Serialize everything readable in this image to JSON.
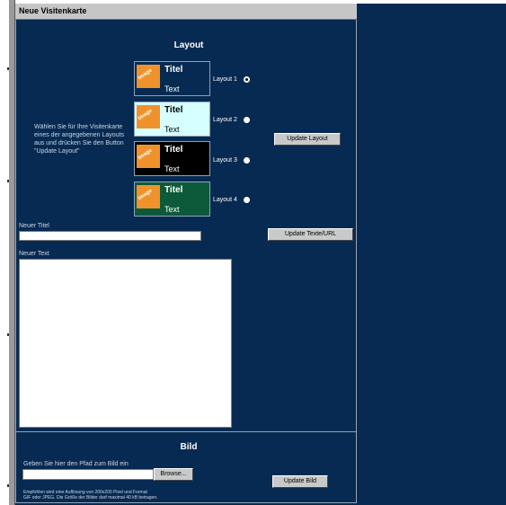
{
  "window": {
    "title": "Neue Visitenkarte"
  },
  "layout_section": {
    "heading": "Layout",
    "instructions": [
      "Wählen Sie für Ihre Visitenkarte",
      "eines der angegebenen Layouts",
      "aus und drücken Sie den Button",
      "\"Update Layout\""
    ],
    "options": [
      {
        "label": "Layout 1",
        "card_title": "Titel",
        "card_text": "Text",
        "image_label": "Image",
        "bg": "#072a52",
        "title_color": "#ffffff",
        "text_color": "#ffffff",
        "checked": true
      },
      {
        "label": "Layout 2",
        "card_title": "Titel",
        "card_text": "Text",
        "image_label": "Image",
        "bg": "#d6ffff",
        "title_color": "#000000",
        "text_color": "#000000",
        "checked": false
      },
      {
        "label": "Layout 3",
        "card_title": "Titel",
        "card_text": "Text",
        "image_label": "Image",
        "bg": "#000000",
        "title_color": "#ffffff",
        "text_color": "#ffffff",
        "checked": false
      },
      {
        "label": "Layout 4",
        "card_title": "Titel",
        "card_text": "Text",
        "image_label": "Image",
        "bg": "#0c5a3a",
        "title_color": "#ffffff",
        "text_color": "#ffffff",
        "checked": false
      }
    ],
    "update_button": "Update Layout"
  },
  "text_section": {
    "title_label": "Neuer Titel",
    "title_value": "",
    "update_button": "Update Texte/URL",
    "text_label": "Neuer Text",
    "text_value": ""
  },
  "image_section": {
    "heading": "Bild",
    "path_label": "Geben Sie hier den Pfad zum Bild ein",
    "path_value": "",
    "browse_button": "Browse...",
    "update_button": "Update Bild",
    "note": [
      "Empfohlen wird eine Auflösung von 200x200 Pixel und Format",
      "GIF oder JPEG. Die Größe der Bilder darf maximal 40 kB betragen."
    ]
  },
  "colors": {
    "background": "#072a52",
    "titlebar": "#c6c6c6",
    "image_placeholder": "#f0922b"
  }
}
